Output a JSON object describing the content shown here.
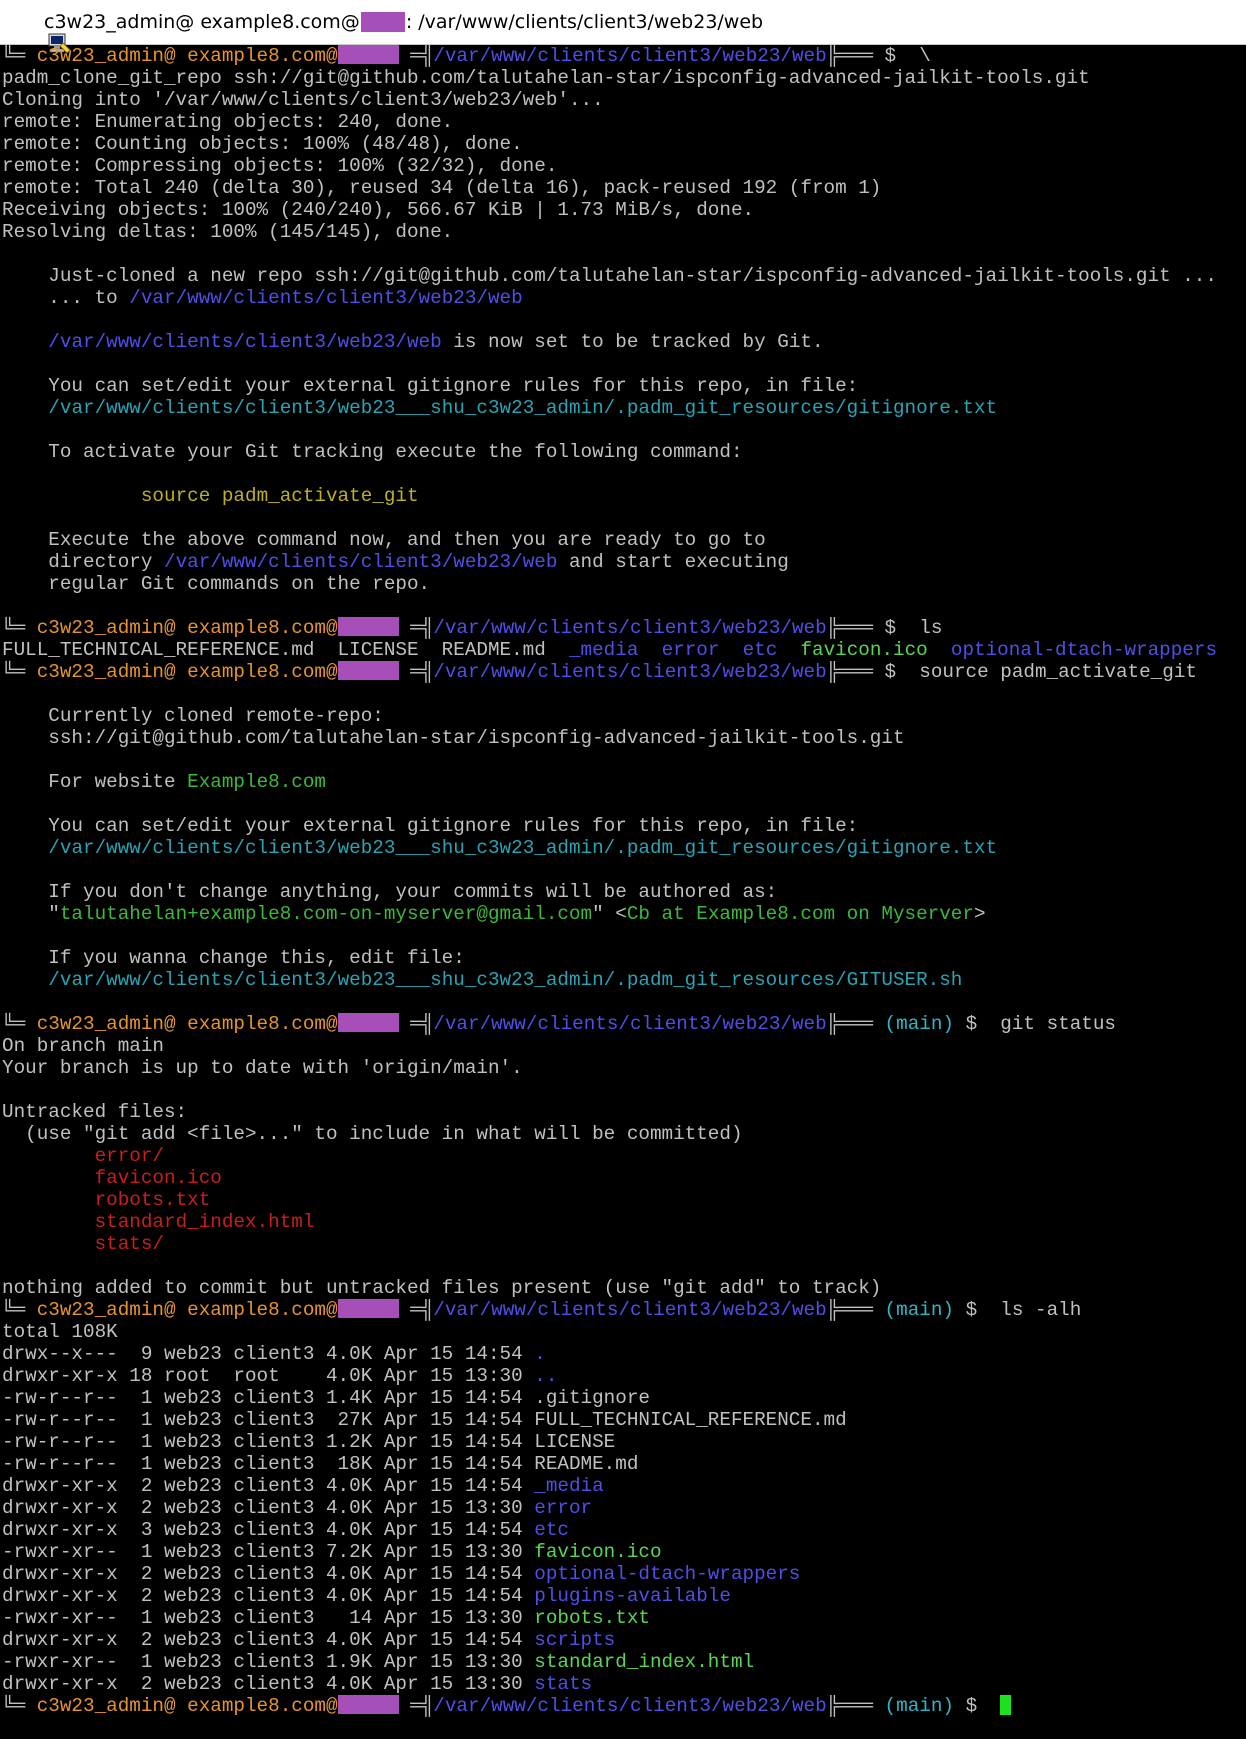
{
  "window": {
    "title_prefix": "c3w23_admin@ example8.com@",
    "title_suffix": ": /var/www/clients/client3/web23/web",
    "icon": "putty-terminal-icon"
  },
  "colors": {
    "user": "#e7942c",
    "path": "#4f4fe8",
    "cyan": "#2aa3b4",
    "yellow": "#bdb021",
    "green": "#3cb93c",
    "red": "#c81e1e",
    "redaction": "#a64fb8",
    "cursor": "#1ee01e"
  },
  "prompt": {
    "corner": "╚═ ",
    "user": "c3w23_admin@ example8.com@",
    "sep": " ═╣",
    "path": "/var/www/clients/client3/web23/web",
    "tail": "╠═══ ",
    "branch": "(main)",
    "dollar": "$"
  },
  "lines": [
    {
      "segments": [
        {
          "t": "PROMPT"
        },
        {
          "t": "  \\",
          "c": "white"
        }
      ]
    },
    {
      "segments": [
        {
          "t": "padm_clone_git_repo ssh://git@github.com/talutahelan-star/ispconfig-advanced-jailkit-tools.git",
          "c": "white"
        }
      ]
    },
    {
      "segments": [
        {
          "t": "Cloning into '/var/www/clients/client3/web23/web'...",
          "c": "white"
        }
      ]
    },
    {
      "segments": [
        {
          "t": "remote: Enumerating objects: 240, done.",
          "c": "white"
        }
      ]
    },
    {
      "segments": [
        {
          "t": "remote: Counting objects: 100% (48/48), done.",
          "c": "white"
        }
      ]
    },
    {
      "segments": [
        {
          "t": "remote: Compressing objects: 100% (32/32), done.",
          "c": "white"
        }
      ]
    },
    {
      "segments": [
        {
          "t": "remote: Total 240 (delta 30), reused 34 (delta 16), pack-reused 192 (from 1)",
          "c": "white"
        }
      ]
    },
    {
      "segments": [
        {
          "t": "Receiving objects: 100% (240/240), 566.67 KiB | 1.73 MiB/s, done.",
          "c": "white"
        }
      ]
    },
    {
      "segments": [
        {
          "t": "Resolving deltas: 100% (145/145), done.",
          "c": "white"
        }
      ]
    },
    {
      "segments": []
    },
    {
      "segments": [
        {
          "t": "    Just-cloned a new repo ",
          "c": "white"
        },
        {
          "t": "ssh://git@github.com/talutahelan-star/ispconfig-advanced-jailkit-tools.git ...",
          "c": "white"
        }
      ]
    },
    {
      "segments": [
        {
          "t": "    ... to ",
          "c": "white"
        },
        {
          "t": "/var/www/clients/client3/web23/web",
          "c": "blue"
        }
      ]
    },
    {
      "segments": []
    },
    {
      "segments": [
        {
          "t": "    ",
          "c": "white"
        },
        {
          "t": "/var/www/clients/client3/web23/web",
          "c": "blue"
        },
        {
          "t": " is now set to be tracked by Git.",
          "c": "white"
        }
      ]
    },
    {
      "segments": []
    },
    {
      "segments": [
        {
          "t": "    You can set/edit your external gitignore rules for this repo, in file:",
          "c": "white"
        }
      ]
    },
    {
      "segments": [
        {
          "t": "    ",
          "c": "white"
        },
        {
          "t": "/var/www/clients/client3/web23___shu_c3w23_admin/.padm_git_resources/gitignore.txt",
          "c": "cyan"
        }
      ]
    },
    {
      "segments": []
    },
    {
      "segments": [
        {
          "t": "    To activate your Git tracking execute the following command:",
          "c": "white"
        }
      ]
    },
    {
      "segments": []
    },
    {
      "segments": [
        {
          "t": "            ",
          "c": "white"
        },
        {
          "t": "source padm_activate_git",
          "c": "yellow"
        }
      ]
    },
    {
      "segments": []
    },
    {
      "segments": [
        {
          "t": "    Execute the above command now, and then you are ready to go to",
          "c": "white"
        }
      ]
    },
    {
      "segments": [
        {
          "t": "    directory ",
          "c": "white"
        },
        {
          "t": "/var/www/clients/client3/web23/web",
          "c": "blue"
        },
        {
          "t": " and start executing",
          "c": "white"
        }
      ]
    },
    {
      "segments": [
        {
          "t": "    regular Git commands on the repo.",
          "c": "white"
        }
      ]
    },
    {
      "segments": []
    },
    {
      "segments": [
        {
          "t": "PROMPT"
        },
        {
          "t": "  ls",
          "c": "white"
        }
      ]
    },
    {
      "segments": [
        {
          "t": "FULL_TECHNICAL_REFERENCE.md  LICENSE  README.md  ",
          "c": "white"
        },
        {
          "t": "_media",
          "c": "blue"
        },
        {
          "t": "  ",
          "c": "white"
        },
        {
          "t": "error",
          "c": "blue"
        },
        {
          "t": "  ",
          "c": "white"
        },
        {
          "t": "etc",
          "c": "blue"
        },
        {
          "t": "  ",
          "c": "white"
        },
        {
          "t": "favicon.ico",
          "c": "lgreen"
        },
        {
          "t": "  ",
          "c": "white"
        },
        {
          "t": "optional-dtach-wrappers",
          "c": "blue"
        }
      ]
    },
    {
      "segments": [
        {
          "t": "PROMPT"
        },
        {
          "t": "  source padm_activate_git",
          "c": "white"
        }
      ]
    },
    {
      "segments": []
    },
    {
      "segments": [
        {
          "t": "    Currently cloned remote-repo:",
          "c": "white"
        }
      ]
    },
    {
      "segments": [
        {
          "t": "    ssh://git@github.com/talutahelan-star/ispconfig-advanced-jailkit-tools.git",
          "c": "white"
        }
      ]
    },
    {
      "segments": []
    },
    {
      "segments": [
        {
          "t": "    For website ",
          "c": "white"
        },
        {
          "t": "Example8.com",
          "c": "green"
        }
      ]
    },
    {
      "segments": []
    },
    {
      "segments": [
        {
          "t": "    You can set/edit your external gitignore rules for this repo, in file:",
          "c": "white"
        }
      ]
    },
    {
      "segments": [
        {
          "t": "    ",
          "c": "white"
        },
        {
          "t": "/var/www/clients/client3/web23___shu_c3w23_admin/.padm_git_resources/gitignore.txt",
          "c": "cyan"
        }
      ]
    },
    {
      "segments": []
    },
    {
      "segments": [
        {
          "t": "    If you don't change anything, your commits will be authored as:",
          "c": "white"
        }
      ]
    },
    {
      "segments": [
        {
          "t": "    \"",
          "c": "white"
        },
        {
          "t": "talutahelan+example8.com-on-myserver@gmail.com",
          "c": "green"
        },
        {
          "t": "\" <",
          "c": "white"
        },
        {
          "t": "Cb at Example8.com on Myserver",
          "c": "green"
        },
        {
          "t": ">",
          "c": "white"
        }
      ]
    },
    {
      "segments": []
    },
    {
      "segments": [
        {
          "t": "    If you wanna change this, edit file:",
          "c": "white"
        }
      ]
    },
    {
      "segments": [
        {
          "t": "    ",
          "c": "white"
        },
        {
          "t": "/var/www/clients/client3/web23___shu_c3w23_admin/.padm_git_resources/GITUSER.sh",
          "c": "cyan"
        }
      ]
    },
    {
      "segments": []
    },
    {
      "segments": [
        {
          "t": "PROMPTB"
        },
        {
          "t": "  git status",
          "c": "white"
        }
      ]
    },
    {
      "segments": [
        {
          "t": "On branch main",
          "c": "white"
        }
      ]
    },
    {
      "segments": [
        {
          "t": "Your branch is up to date with 'origin/main'.",
          "c": "white"
        }
      ]
    },
    {
      "segments": []
    },
    {
      "segments": [
        {
          "t": "Untracked files:",
          "c": "white"
        }
      ]
    },
    {
      "segments": [
        {
          "t": "  (use \"git add <file>...\" to include in what will be committed)",
          "c": "white"
        }
      ]
    },
    {
      "segments": [
        {
          "t": "        ",
          "c": "white"
        },
        {
          "t": "error/",
          "c": "red"
        }
      ]
    },
    {
      "segments": [
        {
          "t": "        ",
          "c": "white"
        },
        {
          "t": "favicon.ico",
          "c": "red"
        }
      ]
    },
    {
      "segments": [
        {
          "t": "        ",
          "c": "white"
        },
        {
          "t": "robots.txt",
          "c": "red"
        }
      ]
    },
    {
      "segments": [
        {
          "t": "        ",
          "c": "white"
        },
        {
          "t": "standard_index.html",
          "c": "red"
        }
      ]
    },
    {
      "segments": [
        {
          "t": "        ",
          "c": "white"
        },
        {
          "t": "stats/",
          "c": "red"
        }
      ]
    },
    {
      "segments": []
    },
    {
      "segments": [
        {
          "t": "nothing added to commit but untracked files present (use \"git add\" to track)",
          "c": "white"
        }
      ]
    },
    {
      "segments": [
        {
          "t": "PROMPTB"
        },
        {
          "t": "  ls -alh",
          "c": "white"
        }
      ]
    },
    {
      "segments": [
        {
          "t": "total 108K",
          "c": "white"
        }
      ]
    },
    {
      "segments": [
        {
          "t": "drwx--x---  9 web23 client3 4.0K Apr 15 14:54 ",
          "c": "white"
        },
        {
          "t": ".",
          "c": "blue"
        }
      ]
    },
    {
      "segments": [
        {
          "t": "drwxr-xr-x 18 root  root    4.0K Apr 15 13:30 ",
          "c": "white"
        },
        {
          "t": "..",
          "c": "blue"
        }
      ]
    },
    {
      "segments": [
        {
          "t": "-rw-r--r--  1 web23 client3 1.4K Apr 15 14:54 .gitignore",
          "c": "white"
        }
      ]
    },
    {
      "segments": [
        {
          "t": "-rw-r--r--  1 web23 client3  27K Apr 15 14:54 FULL_TECHNICAL_REFERENCE.md",
          "c": "white"
        }
      ]
    },
    {
      "segments": [
        {
          "t": "-rw-r--r--  1 web23 client3 1.2K Apr 15 14:54 LICENSE",
          "c": "white"
        }
      ]
    },
    {
      "segments": [
        {
          "t": "-rw-r--r--  1 web23 client3  18K Apr 15 14:54 README.md",
          "c": "white"
        }
      ]
    },
    {
      "segments": [
        {
          "t": "drwxr-xr-x  2 web23 client3 4.0K Apr 15 14:54 ",
          "c": "white"
        },
        {
          "t": "_media",
          "c": "blue"
        }
      ]
    },
    {
      "segments": [
        {
          "t": "drwxr-xr-x  2 web23 client3 4.0K Apr 15 13:30 ",
          "c": "white"
        },
        {
          "t": "error",
          "c": "blue"
        }
      ]
    },
    {
      "segments": [
        {
          "t": "drwxr-xr-x  3 web23 client3 4.0K Apr 15 14:54 ",
          "c": "white"
        },
        {
          "t": "etc",
          "c": "blue"
        }
      ]
    },
    {
      "segments": [
        {
          "t": "-rwxr-xr--  1 web23 client3 7.2K Apr 15 13:30 ",
          "c": "white"
        },
        {
          "t": "favicon.ico",
          "c": "lgreen"
        }
      ]
    },
    {
      "segments": [
        {
          "t": "drwxr-xr-x  2 web23 client3 4.0K Apr 15 14:54 ",
          "c": "white"
        },
        {
          "t": "optional-dtach-wrappers",
          "c": "blue"
        }
      ]
    },
    {
      "segments": [
        {
          "t": "drwxr-xr-x  2 web23 client3 4.0K Apr 15 14:54 ",
          "c": "white"
        },
        {
          "t": "plugins-available",
          "c": "blue"
        }
      ]
    },
    {
      "segments": [
        {
          "t": "-rwxr-xr--  1 web23 client3   14 Apr 15 13:30 ",
          "c": "white"
        },
        {
          "t": "robots.txt",
          "c": "lgreen"
        }
      ]
    },
    {
      "segments": [
        {
          "t": "drwxr-xr-x  2 web23 client3 4.0K Apr 15 14:54 ",
          "c": "white"
        },
        {
          "t": "scripts",
          "c": "blue"
        }
      ]
    },
    {
      "segments": [
        {
          "t": "-rwxr-xr--  1 web23 client3 1.9K Apr 15 13:30 ",
          "c": "white"
        },
        {
          "t": "standard_index.html",
          "c": "lgreen"
        }
      ]
    },
    {
      "segments": [
        {
          "t": "drwxr-xr-x  2 web23 client3 4.0K Apr 15 13:30 ",
          "c": "white"
        },
        {
          "t": "stats",
          "c": "blue"
        }
      ]
    },
    {
      "segments": [
        {
          "t": "PROMPTB"
        },
        {
          "t": "  ",
          "c": "white"
        },
        {
          "t": "CURSOR"
        }
      ]
    }
  ]
}
